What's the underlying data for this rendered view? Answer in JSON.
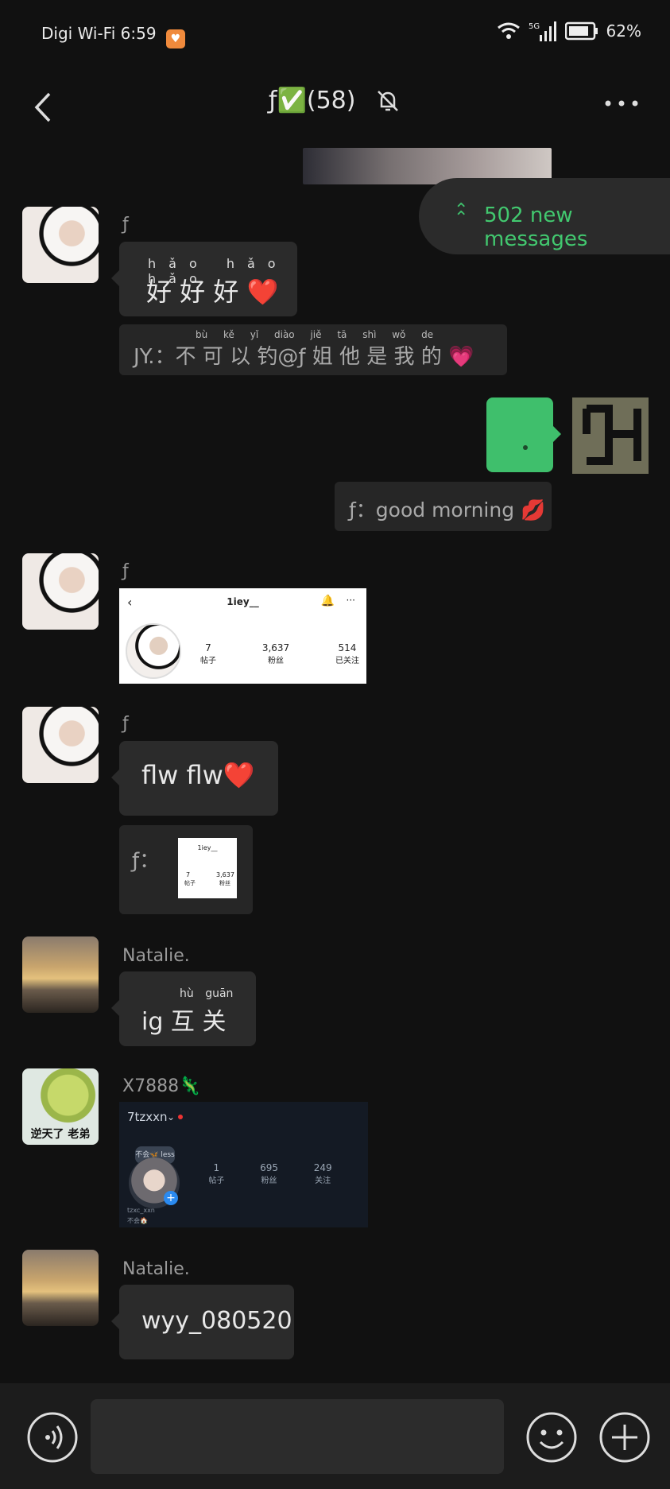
{
  "status": {
    "carrier": "Digi Wi-Fi",
    "time": "6:59",
    "battery": "62%"
  },
  "header": {
    "title_name": "ƒ",
    "title_check": "✅",
    "title_count": "(58)"
  },
  "new_messages": "502 new messages",
  "messages": [
    {
      "sender": "ƒ",
      "text": "好 好 好 ❤️",
      "ruby": [
        "hǎo",
        "hǎo",
        "hǎo"
      ]
    },
    {
      "quote": "JY.：不 可 以 钓@ƒ 姐 他 是 我 的 💗",
      "ruby": "bù kě yǐ diào jiě tā shì wǒ de"
    },
    {
      "quote_reply": "ƒ：good morning 💋"
    },
    {
      "sender": "ƒ",
      "profile_card": {
        "handle": "1iey__",
        "stats": [
          {
            "num": "7",
            "label": "帖子"
          },
          {
            "num": "3,637",
            "label": "粉丝"
          },
          {
            "num": "514",
            "label": "已关注"
          }
        ]
      }
    },
    {
      "sender": "ƒ",
      "text": "flw flw❤️",
      "quote_prefix": "ƒ：",
      "mini_card": {
        "handle": "1iey__",
        "num1": "7",
        "label1": "帖子",
        "num2": "3,637",
        "label2": "粉丝"
      }
    },
    {
      "sender": "Natalie.",
      "text": "ig 互 关",
      "ruby": "hù guān"
    },
    {
      "sender": "X7888🦎",
      "profile_card_dark": {
        "handle": "7tzxxn",
        "stats": [
          {
            "num": "1",
            "label": "帖子"
          },
          {
            "num": "695",
            "label": "粉丝"
          },
          {
            "num": "249",
            "label": "关注"
          }
        ],
        "avatar_caption": "不会🦋 less",
        "bio1": "tzxc_xxn",
        "bio2": "不会🏠"
      }
    },
    {
      "sender": "Natalie.",
      "text": "wyy_080520"
    }
  ],
  "frog_avatar_caption": "逆天了 老弟"
}
